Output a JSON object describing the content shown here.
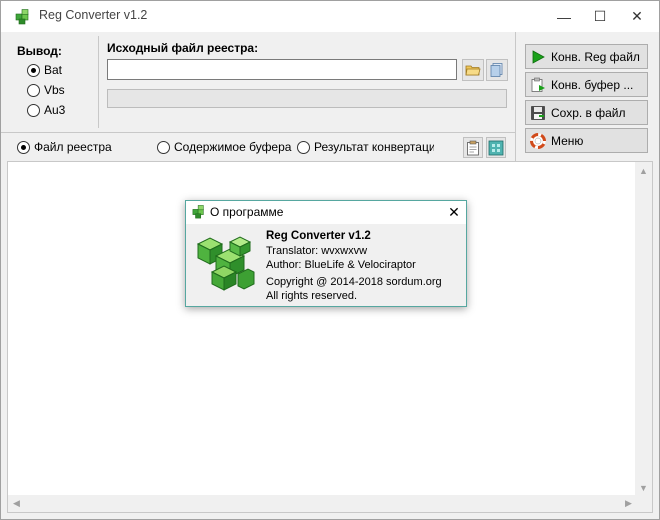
{
  "window": {
    "title": "Reg Converter v1.2",
    "minimize": "—",
    "maximize": "☐",
    "close": "✕"
  },
  "output": {
    "label": "Вывод:",
    "options": [
      "Bat",
      "Vbs",
      "Au3"
    ],
    "selected": "Bat"
  },
  "source": {
    "label": "Исходный файл реестра:",
    "value": "",
    "progress": 0
  },
  "actions": {
    "convert_reg": "Конв. Reg файл",
    "convert_clipboard": "Конв. буфер ...",
    "save_file": "Сохр. в файл",
    "menu": "Меню"
  },
  "view": {
    "options": [
      "Файл реестра",
      "Содержимое буфера",
      "Результат конвертации"
    ],
    "selected": "Файл реестра"
  },
  "dialog": {
    "title": "О программе",
    "close": "✕",
    "app_name": "Reg Converter v1.2",
    "translator": "Translator: wvxwxvw",
    "author": "Author: BlueLife & Velociraptor",
    "copyright": "Copyright @ 2014-2018 sordum.org",
    "rights": "All rights reserved."
  },
  "icons": {
    "app": "green-cube-icon",
    "open_folder": "folder-open-icon",
    "clipboard_copy": "copy-icon",
    "play": "play-icon",
    "clipboard": "clipboard-icon",
    "save": "floppy-icon",
    "menu": "lifebuoy-icon"
  },
  "colors": {
    "accent_green": "#3fa53a",
    "play_green": "#1aa11a",
    "dialog_border": "#56a7a0"
  }
}
